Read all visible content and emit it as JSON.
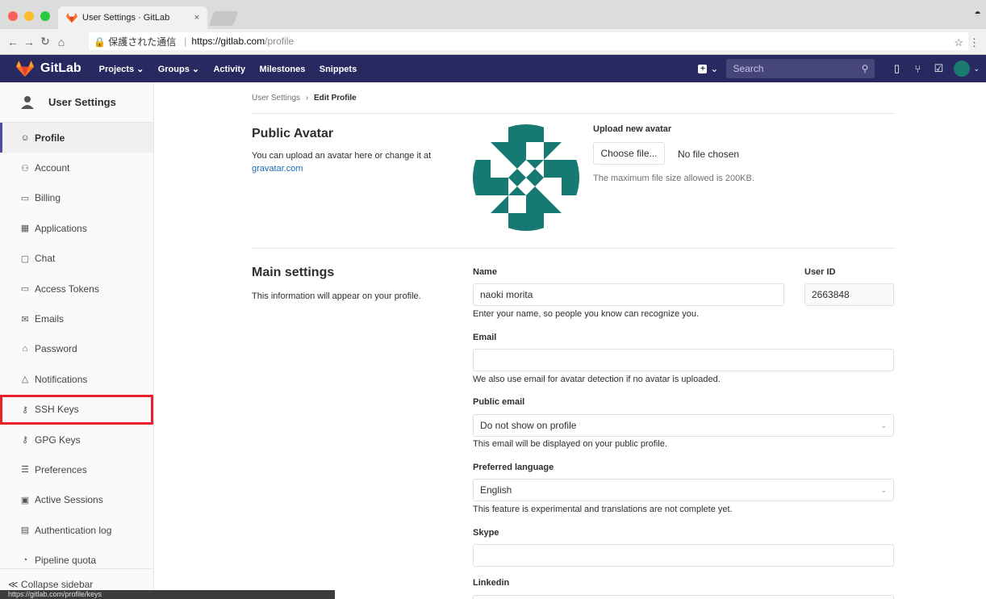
{
  "browser": {
    "tab_title": "User Settings · GitLab",
    "tab_close": "×",
    "secure_label": "🔒 保護された通信",
    "url_host": "https://gitlab.com",
    "url_path": "/profile",
    "status_url": "https://gitlab.com/profile/keys"
  },
  "header": {
    "brand": "GitLab",
    "nav": [
      "Projects ⌄",
      "Groups ⌄",
      "Activity",
      "Milestones",
      "Snippets"
    ],
    "search_placeholder": "Search",
    "new_caret": "⌄",
    "avatar_caret": "⌄"
  },
  "sidebar": {
    "title": "User Settings",
    "items": [
      {
        "label": "Profile",
        "icon": "☺"
      },
      {
        "label": "Account",
        "icon": "⚇"
      },
      {
        "label": "Billing",
        "icon": "▭"
      },
      {
        "label": "Applications",
        "icon": "▦"
      },
      {
        "label": "Chat",
        "icon": "▢"
      },
      {
        "label": "Access Tokens",
        "icon": "▭"
      },
      {
        "label": "Emails",
        "icon": "✉"
      },
      {
        "label": "Password",
        "icon": "⌂"
      },
      {
        "label": "Notifications",
        "icon": "△"
      },
      {
        "label": "SSH Keys",
        "icon": "⚷"
      },
      {
        "label": "GPG Keys",
        "icon": "⚷"
      },
      {
        "label": "Preferences",
        "icon": "☰"
      },
      {
        "label": "Active Sessions",
        "icon": "▣"
      },
      {
        "label": "Authentication log",
        "icon": "▤"
      },
      {
        "label": "Pipeline quota",
        "icon": "◔"
      }
    ],
    "collapse_label": "≪ Collapse sidebar"
  },
  "breadcrumb": {
    "parent": "User Settings",
    "separator": "›",
    "current": "Edit Profile"
  },
  "avatar_section": {
    "title": "Public Avatar",
    "desc": "You can upload an avatar here or change it at",
    "link": "gravatar.com",
    "upload_label": "Upload new avatar",
    "choose_btn": "Choose file...",
    "no_file": "No file chosen",
    "max_size": "The maximum file size allowed is 200KB."
  },
  "main_settings": {
    "title": "Main settings",
    "desc": "This information will appear on your profile.",
    "name_label": "Name",
    "name_value": "naoki morita",
    "name_help": "Enter your name, so people you know can recognize you.",
    "userid_label": "User ID",
    "userid_value": "2663848",
    "email_label": "Email",
    "email_value": "",
    "email_help": "We also use email for avatar detection if no avatar is uploaded.",
    "public_email_label": "Public email",
    "public_email_value": "Do not show on profile",
    "public_email_help": "This email will be displayed on your public profile.",
    "lang_label": "Preferred language",
    "lang_value": "English",
    "lang_help": "This feature is experimental and translations are not complete yet.",
    "skype_label": "Skype",
    "skype_value": "",
    "linkedin_label": "Linkedin"
  },
  "colors": {
    "header_bg": "#292961",
    "active_border": "#4b4ba3",
    "highlight": "#e8202b",
    "link": "#1b69b6",
    "avatar_teal": "#167a73"
  }
}
